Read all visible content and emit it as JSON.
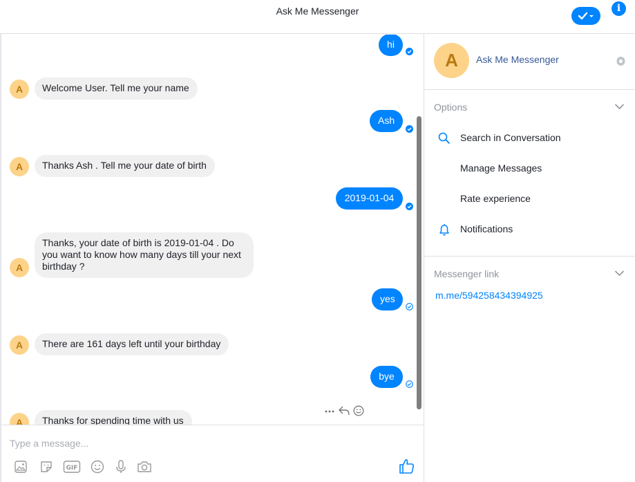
{
  "header": {
    "title": "Ask Me Messenger"
  },
  "conversation": {
    "messages": [
      {
        "from": "user",
        "text": "hi"
      },
      {
        "from": "bot",
        "text": "Welcome User. Tell me your name"
      },
      {
        "from": "user",
        "text": "Ash"
      },
      {
        "from": "bot",
        "text": "Thanks Ash . Tell me your date of birth"
      },
      {
        "from": "user",
        "text": "2019-01-04"
      },
      {
        "from": "bot",
        "text": "Thanks, your date of birth is 2019-01-04 .  Do you want to know how many days till your next birthday ?"
      },
      {
        "from": "user",
        "text": "yes"
      },
      {
        "from": "bot",
        "text": "There are 161 days left until your birthday"
      },
      {
        "from": "user",
        "text": "bye"
      },
      {
        "from": "bot",
        "text": "Thanks for spending time with us"
      }
    ],
    "bot_initial": "A"
  },
  "composer": {
    "placeholder": "Type a message..."
  },
  "panel": {
    "avatar_initial": "A",
    "name": "Ask Me Messenger",
    "options_title": "Options",
    "options": [
      {
        "label": "Search in Conversation",
        "icon": "search-icon"
      },
      {
        "label": "Manage Messages",
        "icon": ""
      },
      {
        "label": "Rate experience",
        "icon": ""
      },
      {
        "label": "Notifications",
        "icon": "bell-icon"
      }
    ],
    "link_title": "Messenger link",
    "link": "m.me/594258434394925"
  },
  "colors": {
    "accent": "#0084ff",
    "bubble_in": "#f1f0f0",
    "avatar": "#fdd38a",
    "link_name": "#365899"
  }
}
